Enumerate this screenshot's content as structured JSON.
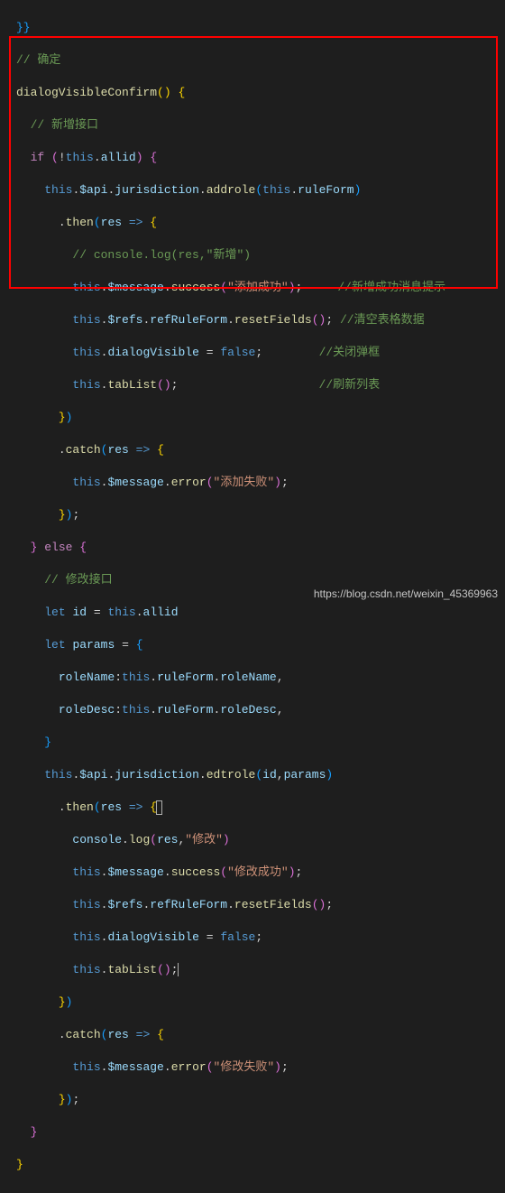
{
  "lines": {
    "l0a": "}}",
    "l0b_c": "// 确定",
    "fn_name": "dialogVisibleConfirm",
    "l2_c": "// 新增接口",
    "if_kw": "if",
    "this_kw": "this",
    "allid": "allid",
    "api": "$api",
    "jurisdiction": "jurisdiction",
    "addrole": "addrole",
    "ruleForm": "ruleForm",
    "then": "then",
    "res": "res",
    "arrow": "=>",
    "l6_c": "// console.log(res,\"新增\")",
    "message": "$message",
    "success": "success",
    "str_add_ok": "\"添加成功\"",
    "c_add_ok": "//新增成功消息提示",
    "refs": "$refs",
    "refRuleForm": "refRuleForm",
    "resetFields": "resetFields",
    "c_clear": "//清空表格数据",
    "dialogVisible": "dialogVisible",
    "false_kw": "false",
    "c_close": "//关闭弹框",
    "tabList": "tabList",
    "c_refresh": "//刷新列表",
    "catch": "catch",
    "error": "error",
    "str_add_fail": "\"添加失败\"",
    "else_kw": "else",
    "l_mod_c": "// 修改接口",
    "let_kw": "let",
    "id": "id",
    "params": "params",
    "roleName": "roleName",
    "roleDesc": "roleDesc",
    "edtrole": "edtrole",
    "console": "console",
    "log": "log",
    "str_mod": "\"修改\"",
    "str_mod_ok": "\"修改成功\"",
    "str_mod_fail": "\"修改失败\"",
    "watermark": "https://blog.csdn.net/weixin_45369963"
  }
}
